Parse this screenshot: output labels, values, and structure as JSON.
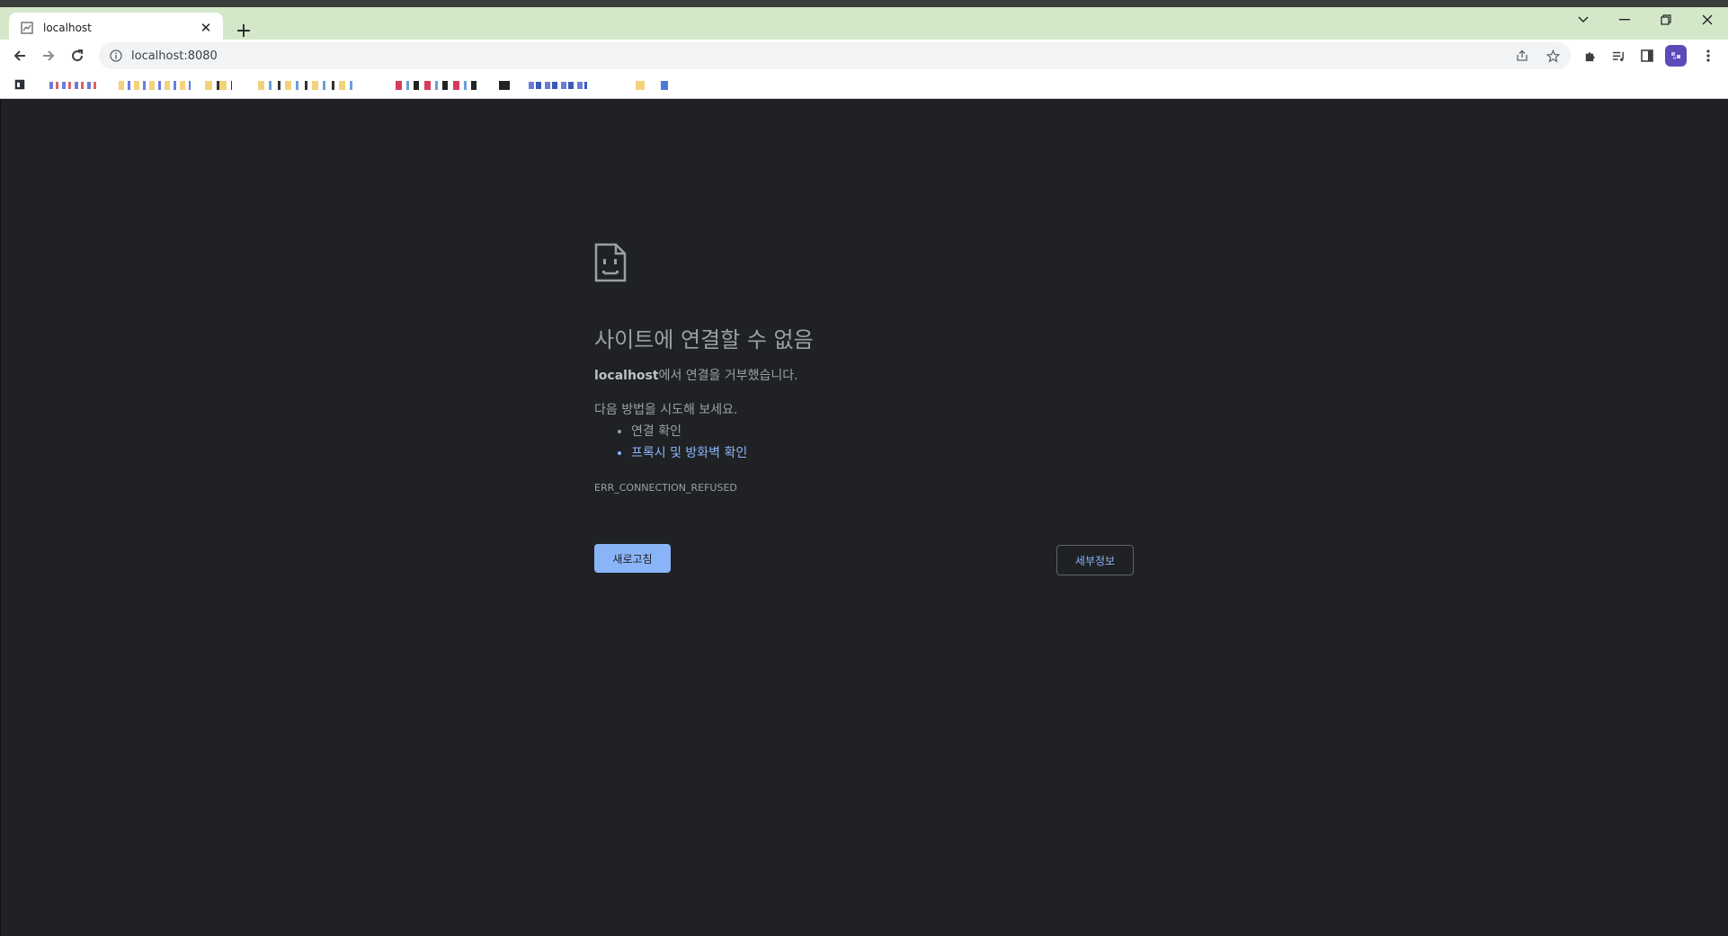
{
  "browser": {
    "tab": {
      "title": "localhost"
    },
    "url": "localhost:8080"
  },
  "error_page": {
    "title": "사이트에 연결할 수 없음",
    "host": "localhost",
    "description_suffix": "에서 연결을 거부했습니다.",
    "try_intro": "다음 방법을 시도해 보세요.",
    "suggestions": [
      {
        "label": "연결 확인"
      },
      {
        "label": "프록시 및 방화벽 확인"
      }
    ],
    "error_code": "ERR_CONNECTION_REFUSED",
    "reload_label": "새로고침",
    "details_label": "세부정보"
  },
  "colors": {
    "page_background": "#202124",
    "tab_strip": "#d3e8c8",
    "primary_button": "#8ab4f8",
    "link": "#8ab4f8",
    "text": "#9aa0a6"
  }
}
